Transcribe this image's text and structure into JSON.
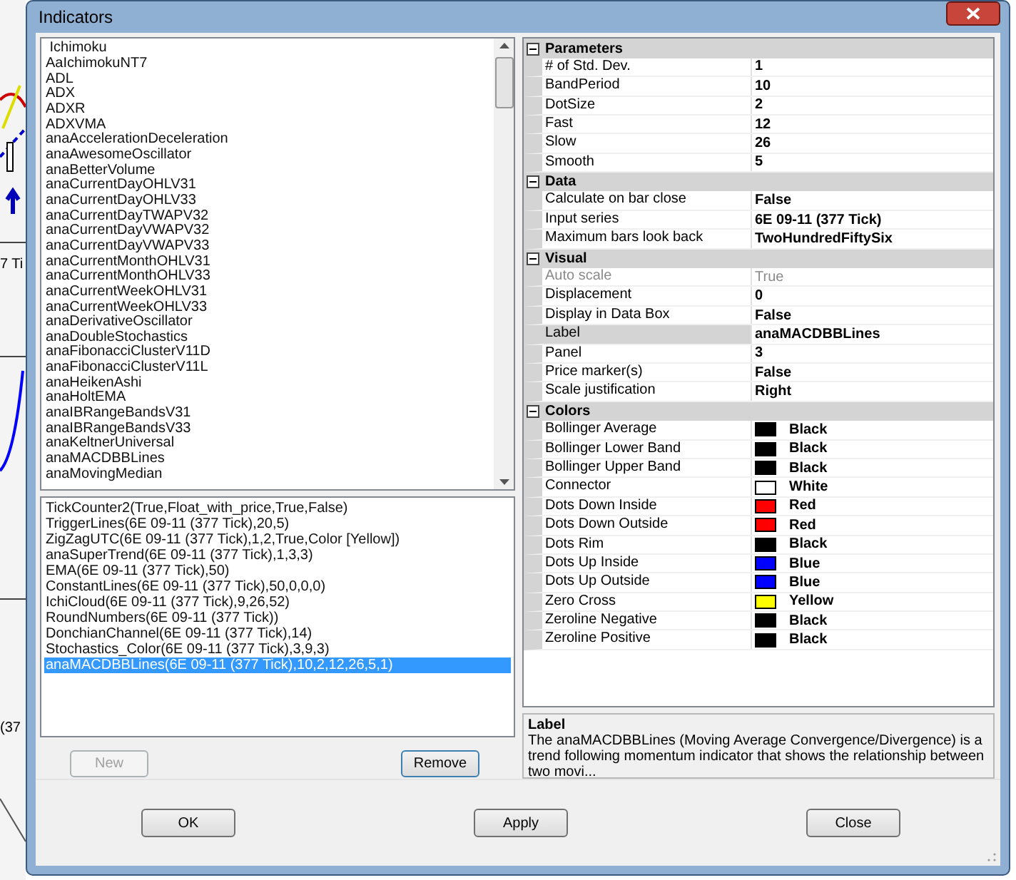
{
  "backdrop": {
    "texts": [
      "7 Ti",
      "(37"
    ]
  },
  "window": {
    "title": "Indicators"
  },
  "indicator_list": {
    "items": [
      {
        "label": " Ichimoku",
        "selected": false
      },
      {
        "label": "AaIchimokuNT7",
        "selected": false
      },
      {
        "label": "ADL",
        "selected": false
      },
      {
        "label": "ADX",
        "selected": false
      },
      {
        "label": "ADXR",
        "selected": false
      },
      {
        "label": "ADXVMA",
        "selected": false
      },
      {
        "label": "anaAccelerationDeceleration",
        "selected": false
      },
      {
        "label": "anaAwesomeOscillator",
        "selected": false
      },
      {
        "label": "anaBetterVolume",
        "selected": false
      },
      {
        "label": "anaCurrentDayOHLV31",
        "selected": false
      },
      {
        "label": "anaCurrentDayOHLV33",
        "selected": false
      },
      {
        "label": "anaCurrentDayTWAPV32",
        "selected": false
      },
      {
        "label": "anaCurrentDayVWAPV32",
        "selected": false
      },
      {
        "label": "anaCurrentDayVWAPV33",
        "selected": false
      },
      {
        "label": "anaCurrentMonthOHLV31",
        "selected": false
      },
      {
        "label": "anaCurrentMonthOHLV33",
        "selected": false
      },
      {
        "label": "anaCurrentWeekOHLV31",
        "selected": false
      },
      {
        "label": "anaCurrentWeekOHLV33",
        "selected": false
      },
      {
        "label": "anaDerivativeOscillator",
        "selected": false
      },
      {
        "label": "anaDoubleStochastics",
        "selected": false
      },
      {
        "label": "anaFibonacciClusterV11D",
        "selected": false
      },
      {
        "label": "anaFibonacciClusterV11L",
        "selected": false
      },
      {
        "label": "anaHeikenAshi",
        "selected": false
      },
      {
        "label": "anaHoltEMA",
        "selected": false
      },
      {
        "label": "anaIBRangeBandsV31",
        "selected": false
      },
      {
        "label": "anaIBRangeBandsV33",
        "selected": false
      },
      {
        "label": "anaKeltnerUniversal",
        "selected": false
      },
      {
        "label": "anaMACDBBLines",
        "selected": false
      },
      {
        "label": "anaMovingMedian",
        "selected": false
      }
    ]
  },
  "applied_list": {
    "items": [
      {
        "label": "TickCounter2(True,Float_with_price,True,False)",
        "selected": false
      },
      {
        "label": "TriggerLines(6E 09-11 (377 Tick),20,5)",
        "selected": false
      },
      {
        "label": "ZigZagUTC(6E 09-11 (377 Tick),1,2,True,Color [Yellow])",
        "selected": false
      },
      {
        "label": "anaSuperTrend(6E 09-11 (377 Tick),1,3,3)",
        "selected": false
      },
      {
        "label": "EMA(6E 09-11 (377 Tick),50)",
        "selected": false
      },
      {
        "label": "ConstantLines(6E 09-11 (377 Tick),50,0,0,0)",
        "selected": false
      },
      {
        "label": "IchiCloud(6E 09-11 (377 Tick),9,26,52)",
        "selected": false
      },
      {
        "label": "RoundNumbers(6E 09-11 (377 Tick))",
        "selected": false
      },
      {
        "label": "DonchianChannel(6E 09-11 (377 Tick),14)",
        "selected": false
      },
      {
        "label": "Stochastics_Color(6E 09-11 (377 Tick),3,9,3)",
        "selected": false
      },
      {
        "label": "anaMACDBBLines(6E 09-11 (377 Tick),10,2,12,26,5,1)",
        "selected": true
      }
    ]
  },
  "list_buttons": [
    {
      "label": "New",
      "disabled": true
    },
    {
      "label": "Remove",
      "disabled": false
    }
  ],
  "property_grid": {
    "categories": [
      {
        "name": "Parameters",
        "expanded": true,
        "properties": [
          {
            "kind": "text",
            "name": "# of Std. Dev.",
            "value": "1",
            "disabled": false,
            "selected": false
          },
          {
            "kind": "text",
            "name": "BandPeriod",
            "value": "10",
            "disabled": false,
            "selected": false
          },
          {
            "kind": "text",
            "name": "DotSize",
            "value": "2",
            "disabled": false,
            "selected": false
          },
          {
            "kind": "text",
            "name": "Fast",
            "value": "12",
            "disabled": false,
            "selected": false
          },
          {
            "kind": "text",
            "name": "Slow",
            "value": "26",
            "disabled": false,
            "selected": false
          },
          {
            "kind": "text",
            "name": "Smooth",
            "value": "5",
            "disabled": false,
            "selected": false
          }
        ]
      },
      {
        "name": "Data",
        "expanded": true,
        "properties": [
          {
            "kind": "text",
            "name": "Calculate on bar close",
            "value": "False",
            "disabled": false,
            "selected": false
          },
          {
            "kind": "text",
            "name": "Input series",
            "value": "6E 09-11 (377 Tick)",
            "disabled": false,
            "selected": false
          },
          {
            "kind": "text",
            "name": "Maximum bars look back",
            "value": "TwoHundredFiftySix",
            "disabled": false,
            "selected": false
          }
        ]
      },
      {
        "name": "Visual",
        "expanded": true,
        "properties": [
          {
            "kind": "text",
            "name": "Auto scale",
            "value": "True",
            "disabled": true,
            "selected": false
          },
          {
            "kind": "text",
            "name": "Displacement",
            "value": "0",
            "disabled": false,
            "selected": false
          },
          {
            "kind": "text",
            "name": "Display in Data Box",
            "value": "False",
            "disabled": false,
            "selected": false
          },
          {
            "kind": "text",
            "name": "Label",
            "value": "anaMACDBBLines",
            "disabled": false,
            "selected": true
          },
          {
            "kind": "text",
            "name": "Panel",
            "value": "3",
            "disabled": false,
            "selected": false
          },
          {
            "kind": "text",
            "name": "Price marker(s)",
            "value": "False",
            "disabled": false,
            "selected": false
          },
          {
            "kind": "text",
            "name": "Scale justification",
            "value": "Right",
            "disabled": false,
            "selected": false
          }
        ]
      },
      {
        "name": "Colors",
        "expanded": true,
        "properties": [
          {
            "kind": "color",
            "name": "Bollinger Average",
            "value": "Black",
            "color": "#000000",
            "disabled": false,
            "selected": false
          },
          {
            "kind": "color",
            "name": "Bollinger Lower Band",
            "value": "Black",
            "color": "#000000",
            "disabled": false,
            "selected": false
          },
          {
            "kind": "color",
            "name": "Bollinger Upper Band",
            "value": "Black",
            "color": "#000000",
            "disabled": false,
            "selected": false
          },
          {
            "kind": "color",
            "name": "Connector",
            "value": "White",
            "color": "#ffffff",
            "disabled": false,
            "selected": false
          },
          {
            "kind": "color",
            "name": "Dots Down Inside",
            "value": "Red",
            "color": "#ff0000",
            "disabled": false,
            "selected": false
          },
          {
            "kind": "color",
            "name": "Dots Down Outside",
            "value": "Red",
            "color": "#ff0000",
            "disabled": false,
            "selected": false
          },
          {
            "kind": "color",
            "name": "Dots Rim",
            "value": "Black",
            "color": "#000000",
            "disabled": false,
            "selected": false
          },
          {
            "kind": "color",
            "name": "Dots Up Inside",
            "value": "Blue",
            "color": "#0000ff",
            "disabled": false,
            "selected": false
          },
          {
            "kind": "color",
            "name": "Dots Up Outside",
            "value": "Blue",
            "color": "#0000ff",
            "disabled": false,
            "selected": false
          },
          {
            "kind": "color",
            "name": "Zero Cross",
            "value": "Yellow",
            "color": "#ffff00",
            "disabled": false,
            "selected": false
          },
          {
            "kind": "color",
            "name": "Zeroline Negative",
            "value": "Black",
            "color": "#000000",
            "disabled": false,
            "selected": false
          },
          {
            "kind": "color",
            "name": "Zeroline Positive",
            "value": "Black",
            "color": "#000000",
            "disabled": false,
            "selected": false
          }
        ]
      }
    ]
  },
  "description": {
    "title": "Label",
    "text": "The anaMACDBBLines (Moving Average Convergence/Divergence) is a trend following momentum indicator that shows the relationship between two movi..."
  },
  "dialog_buttons": [
    {
      "label": "OK",
      "disabled": false
    },
    {
      "label": "Apply",
      "disabled": false
    },
    {
      "label": "Close",
      "disabled": false
    }
  ]
}
